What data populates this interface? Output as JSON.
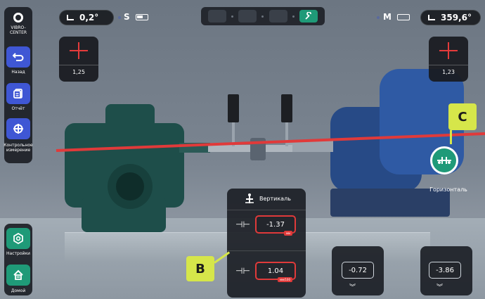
{
  "top_left_readout": {
    "value": "0,2°",
    "mode_letter": "S"
  },
  "top_right_readout": {
    "value": "359,6°",
    "mode_letter": "M"
  },
  "nav": {
    "logo_label": "VIBRO-CENTER",
    "back_label": "Назад",
    "report_label": "Отчёт",
    "control_label": "Контрольное измерение",
    "settings_label": "Настройки",
    "home_label": "Домой"
  },
  "left_mini": {
    "value": "1,25"
  },
  "right_mini": {
    "value": "1,23"
  },
  "vertical_panel": {
    "title": "Вертикаль",
    "offset_value": "-1.37",
    "offset_unit": "мм",
    "angle_value": "1.04",
    "angle_unit": "мм/100"
  },
  "horizontal_button": {
    "label": "Горизонталь"
  },
  "bottom_right": {
    "left_value": "-0.72",
    "right_value": "-3.86"
  },
  "callouts": {
    "b": "B",
    "c": "C"
  },
  "colors": {
    "accent_blue": "#3f57d4",
    "accent_green": "#1f9a78",
    "alert_red": "#e03a3a",
    "tag_yellow": "#d6e64a"
  }
}
